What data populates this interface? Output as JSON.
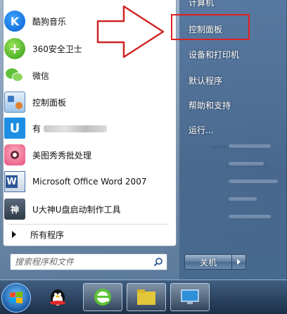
{
  "left_pane": {
    "programs": [
      {
        "label": "酷狗音乐",
        "icon": "kugou-music-icon",
        "glyph": "K"
      },
      {
        "label": "360安全卫士",
        "icon": "360-security-icon",
        "glyph": "+"
      },
      {
        "label": "微信",
        "icon": "wechat-icon"
      },
      {
        "label": "控制面板",
        "icon": "control-panel-icon"
      },
      {
        "label": "有",
        "icon": "u-app-icon",
        "glyph": "U"
      },
      {
        "label": "美图秀秀批处理",
        "icon": "meitu-icon"
      },
      {
        "label": "Microsoft Office Word 2007",
        "icon": "word-icon",
        "glyph": "W"
      },
      {
        "label": "U大神U盘启动制作工具",
        "icon": "ushen-usb-tool-icon",
        "glyph": "神"
      }
    ],
    "all_programs_label": "所有程序",
    "search": {
      "placeholder": "搜索程序和文件"
    }
  },
  "right_pane": {
    "items": [
      {
        "label": "计算机"
      },
      {
        "label": "控制面板"
      },
      {
        "label": "设备和打印机"
      },
      {
        "label": "默认程序"
      },
      {
        "label": "帮助和支持"
      },
      {
        "label": "运行..."
      }
    ],
    "shutdown_label": "关机"
  },
  "colors": {
    "highlight": "#e02020",
    "arrow_outline": "#d02424"
  }
}
